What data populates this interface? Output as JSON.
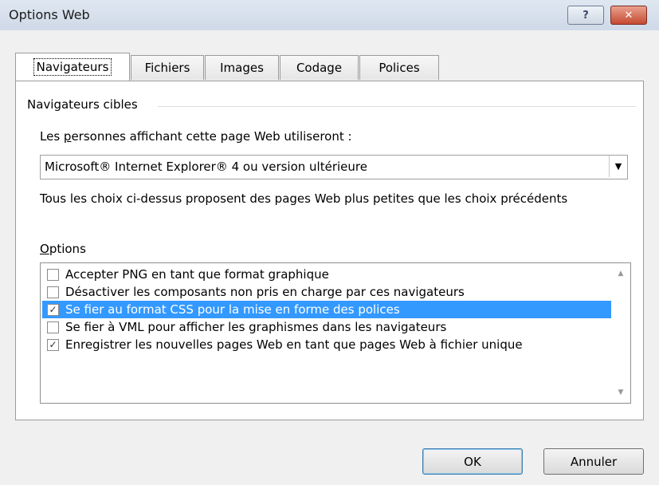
{
  "window": {
    "title": "Options Web",
    "help_label": "?",
    "close_label": "✕"
  },
  "tabs": [
    "Navigateurs",
    "Fichiers",
    "Images",
    "Codage",
    "Polices"
  ],
  "browsers": {
    "group_label": "Navigateurs cibles",
    "people_label_pre": "Les ",
    "people_label_ul": "p",
    "people_label_post": "ersonnes affichant cette page Web utiliseront :",
    "selected_value": "Microsoft® Internet Explorer® 4 ou version ultérieure",
    "description": "Tous les choix ci-dessus proposent des pages Web plus petites que les choix précédents"
  },
  "options": {
    "label_ul": "O",
    "label_rest": "ptions",
    "items": [
      {
        "label": "Accepter PNG en tant que format graphique",
        "checked": false
      },
      {
        "label": "Désactiver les composants non pris en charge par ces navigateurs",
        "checked": false
      },
      {
        "label": "Se fier au format CSS pour la mise en forme des polices",
        "checked": true
      },
      {
        "label": "Se fier à VML pour afficher les graphismes dans les navigateurs",
        "checked": false
      },
      {
        "label": "Enregistrer les nouvelles pages Web en tant que pages Web à fichier unique",
        "checked": true
      }
    ]
  },
  "buttons": {
    "ok": "OK",
    "cancel": "Annuler"
  }
}
